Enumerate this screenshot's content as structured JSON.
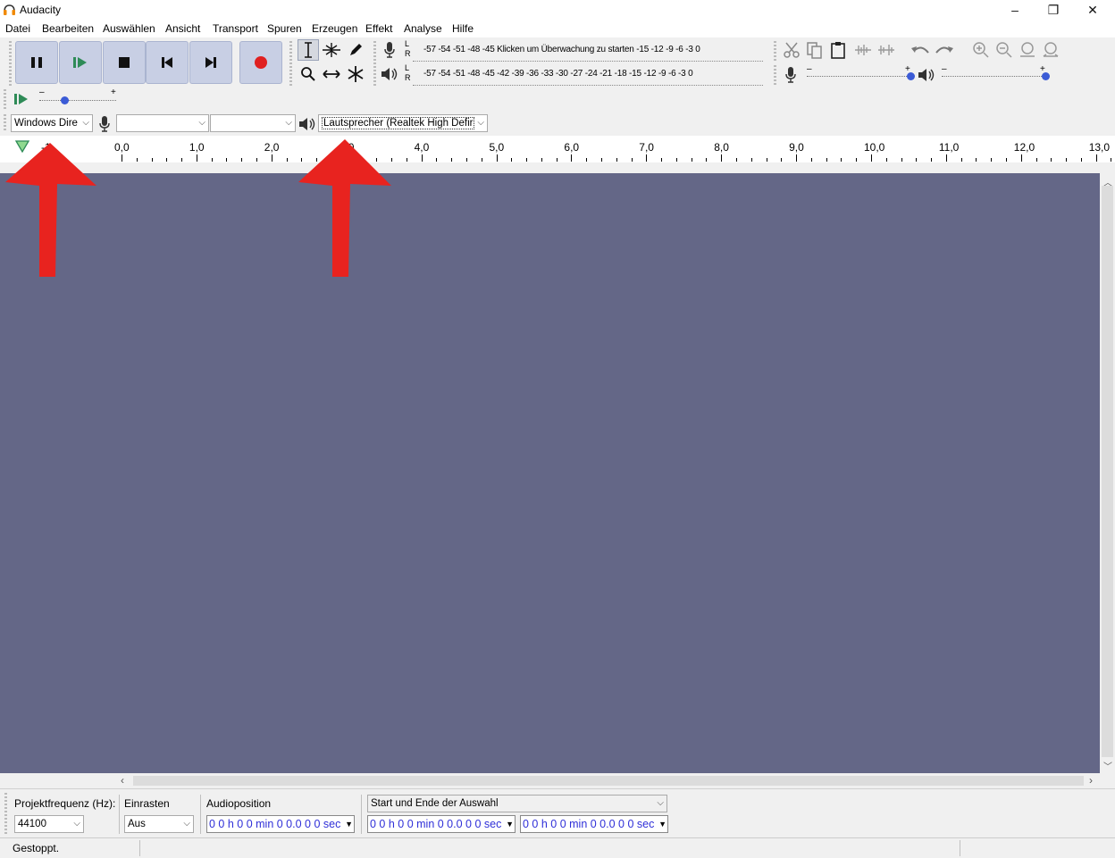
{
  "window": {
    "title": "Audacity",
    "minimize": "–",
    "restore": "❐",
    "close": "✕"
  },
  "menu": [
    "Datei",
    "Bearbeiten",
    "Auswählen",
    "Ansicht",
    "Transport",
    "Spuren",
    "Erzeugen",
    "Effekt",
    "Analyse",
    "Hilfe"
  ],
  "meters": {
    "rec_scale": "-57 -54 -51 -48 -45 Klicken um Überwachung zu starten -15 -12  -9  -6  -3  0",
    "play_scale": "-57 -54 -51 -48 -45 -42 -39 -36 -33 -30 -27 -24 -21 -18 -15 -12  -9  -6  -3  0",
    "l": "L",
    "r": "R"
  },
  "mixer": {
    "minus": "–",
    "plus": "+"
  },
  "device": {
    "host": "Windows Dire",
    "rec_device": "",
    "channels": "",
    "play_device": "Lautsprecher (Realtek High Defir"
  },
  "ruler": {
    "start": "-1",
    "ticks": [
      "0,0",
      "1,0",
      "2,0",
      "3,0",
      "4,0",
      "5,0",
      "6,0",
      "7,0",
      "8,0",
      "9,0",
      "10,0",
      "11,0",
      "12,0",
      "13,0"
    ]
  },
  "selection_bar": {
    "rate_label": "Projektfrequenz (Hz):",
    "rate_value": "44100",
    "snap_label": "Einrasten",
    "snap_value": "Aus",
    "audio_pos_label": "Audioposition",
    "audio_pos_value": "0 0 h 0 0 min 0 0.0 0 0 sec",
    "sel_mode": "Start und Ende der Auswahl",
    "sel_start": "0 0 h 0 0 min 0 0.0 0 0 sec",
    "sel_end": "0 0 h 0 0 min 0 0.0 0 0 sec"
  },
  "status": {
    "text": "Gestoppt."
  },
  "colors": {
    "track_bg": "#646787",
    "annotation_arrow": "#e8231f",
    "record": "#e02020",
    "play": "#2e8b57"
  }
}
